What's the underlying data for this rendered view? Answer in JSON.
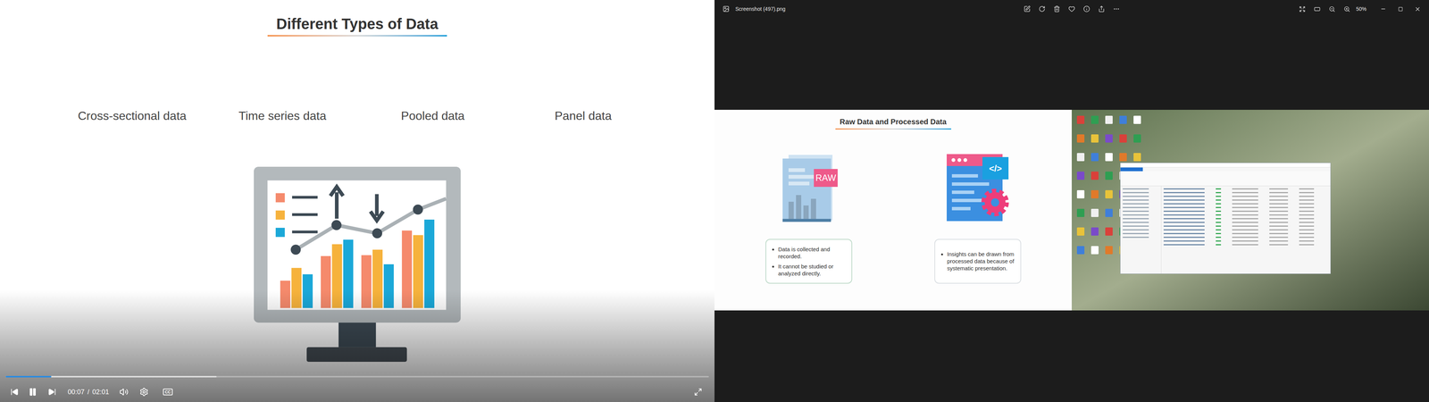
{
  "video_player": {
    "slide": {
      "title": "Different Types of Data",
      "labels": [
        "Cross-sectional data",
        "Time series data",
        "Pooled data",
        "Panel data"
      ],
      "chart": {
        "series": [
          {
            "color": "#f58a6c",
            "values": [
              30,
              57,
              58,
              85
            ]
          },
          {
            "color": "#f6b23c",
            "values": [
              44,
              70,
              64,
              80
            ]
          },
          {
            "color": "#1ba8d8",
            "values": [
              37,
              75,
              48,
              97
            ]
          }
        ],
        "line": [
          64,
          91,
          82,
          108
        ]
      }
    },
    "controls": {
      "playing": true,
      "current_time": "00:07",
      "separator": "/",
      "duration": "02:01",
      "progress": {
        "level": 0.065
      },
      "buffered": {
        "level": 0.3
      },
      "cc_label": "CC"
    }
  },
  "image_viewer": {
    "window": {
      "title": "Screenshot (497).png"
    },
    "zoom": "50%",
    "image": {
      "slide": {
        "title": "Raw Data and Processed Data",
        "items": [
          {
            "badge": "RAW",
            "bullets": [
              "Data is collected and recorded.",
              "It cannot be studied or analyzed directly."
            ]
          },
          {
            "badge": "</>",
            "bullets": [
              "Insights can be drawn from processed data because of systematic presentation."
            ]
          }
        ]
      }
    }
  }
}
